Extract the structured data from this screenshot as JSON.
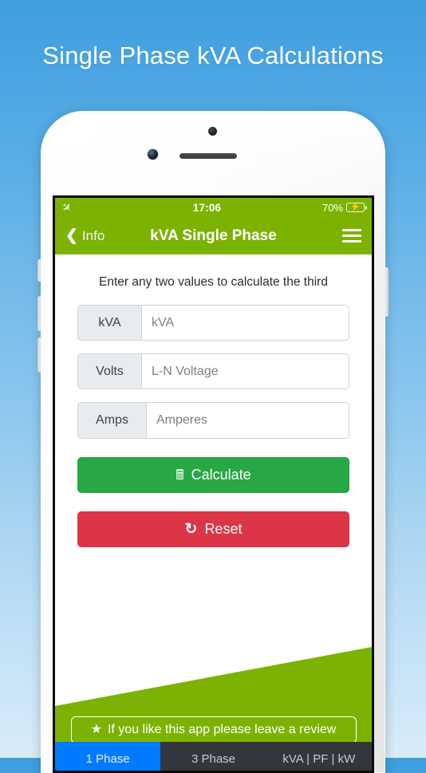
{
  "hero": {
    "title": "Single Phase kVA Calculations"
  },
  "status_bar": {
    "airplane_icon": "airplane-mode-icon",
    "time": "17:06",
    "battery_percent": "70%",
    "battery_level": 70,
    "charging_icon": "charging-bolt-icon"
  },
  "nav_bar": {
    "back_icon": "chevron-left-icon",
    "back_label": "Info",
    "title": "kVA Single Phase",
    "menu_icon": "hamburger-menu-icon"
  },
  "content": {
    "instruction": "Enter any two values to calculate the third",
    "fields": [
      {
        "label": "kVA",
        "placeholder": "kVA",
        "value": ""
      },
      {
        "label": "Volts",
        "placeholder": "L-N Voltage",
        "value": ""
      },
      {
        "label": "Amps",
        "placeholder": "Amperes",
        "value": ""
      }
    ],
    "calculate_button": {
      "label": "Calculate",
      "icon": "calculator-icon"
    },
    "reset_button": {
      "label": "Reset",
      "icon": "refresh-icon"
    },
    "review_button": {
      "label": "If you like this app please leave a review",
      "icon": "star-icon"
    }
  },
  "tab_bar": {
    "tabs": [
      {
        "label": "1 Phase",
        "active": true
      },
      {
        "label": "3 Phase",
        "active": false
      },
      {
        "label": "kVA | PF | kW",
        "active": false
      }
    ]
  },
  "colors": {
    "brand_green": "#7cb302",
    "calculate_green": "#28a745",
    "reset_red": "#dc3545",
    "active_tab_blue": "#007bff",
    "tab_bar_dark": "#33373d",
    "background_blue": "#5aaee6"
  }
}
